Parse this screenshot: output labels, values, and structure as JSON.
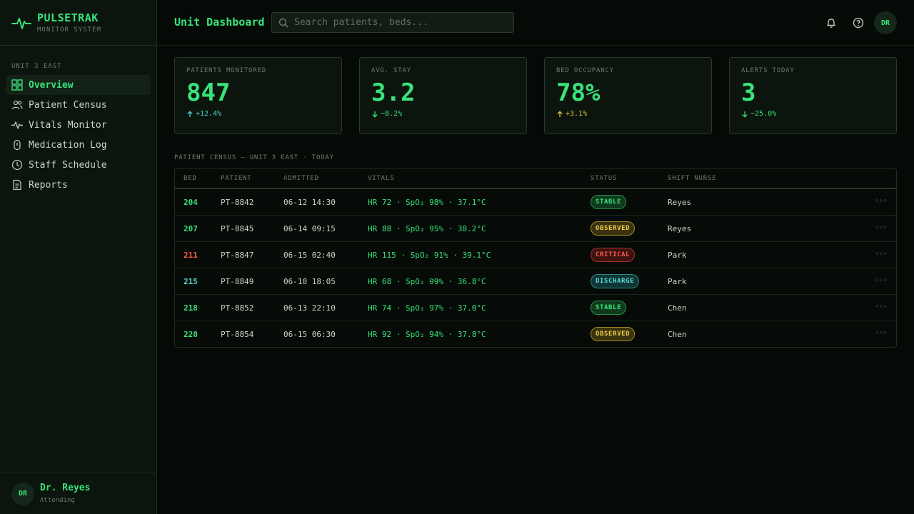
{
  "brand": {
    "name": "PULSETRAK",
    "subtitle": "MONITOR SYSTEM",
    "icon": "pulse-icon"
  },
  "sidebar": {
    "section_label": "UNIT 3 EAST",
    "items": [
      {
        "label": "Overview",
        "icon": "grid-icon",
        "active": true
      },
      {
        "label": "Patient Census",
        "icon": "users-icon",
        "active": false
      },
      {
        "label": "Vitals Monitor",
        "icon": "pulse-icon",
        "active": false
      },
      {
        "label": "Medication Log",
        "icon": "capsule-icon",
        "active": false
      },
      {
        "label": "Staff Schedule",
        "icon": "clock-icon",
        "active": false
      },
      {
        "label": "Reports",
        "icon": "document-icon",
        "active": false
      }
    ],
    "user": {
      "initials": "DR",
      "name": "Dr. Reyes",
      "role": "Attending"
    }
  },
  "header": {
    "title": "Unit Dashboard",
    "search_placeholder": "Search patients, beds...",
    "avatar_initials": "DR"
  },
  "stats": [
    {
      "label": "PATIENTS MONITORED",
      "value": "847",
      "delta": "+12.4%",
      "direction": "up",
      "color": "#4cd3d0"
    },
    {
      "label": "AVG. STAY",
      "value": "3.2",
      "delta": "−8.2%",
      "direction": "down",
      "color": "#39e27a"
    },
    {
      "label": "BED OCCUPANCY",
      "value": "78%",
      "delta": "+3.1%",
      "direction": "up",
      "color": "#e0c341"
    },
    {
      "label": "ALERTS TODAY",
      "value": "3",
      "delta": "−25.0%",
      "direction": "down",
      "color": "#39e27a"
    }
  ],
  "table": {
    "caption": "PATIENT CENSUS — UNIT 3 EAST · TODAY",
    "columns": [
      "BED",
      "PATIENT",
      "ADMITTED",
      "VITALS",
      "STATUS",
      "SHIFT NURSE"
    ],
    "rows": [
      {
        "bed": "204",
        "patient": "PT-8842",
        "admitted": "06-12 14:30",
        "vitals": "HR 72 · SpO₂ 98% · 37.1°C",
        "status": "STABLE",
        "nurse": "Reyes"
      },
      {
        "bed": "207",
        "patient": "PT-8845",
        "admitted": "06-14 09:15",
        "vitals": "HR 88 · SpO₂ 95% · 38.2°C",
        "status": "OBSERVED",
        "nurse": "Reyes"
      },
      {
        "bed": "211",
        "patient": "PT-8847",
        "admitted": "06-15 02:40",
        "vitals": "HR 115 · SpO₂ 91% · 39.1°C",
        "status": "CRITICAL",
        "nurse": "Park"
      },
      {
        "bed": "215",
        "patient": "PT-8849",
        "admitted": "06-10 18:05",
        "vitals": "HR 68 · SpO₂ 99% · 36.8°C",
        "status": "DISCHARGE",
        "nurse": "Park"
      },
      {
        "bed": "218",
        "patient": "PT-8852",
        "admitted": "06-13 22:10",
        "vitals": "HR 74 · SpO₂ 97% · 37.0°C",
        "status": "STABLE",
        "nurse": "Chen"
      },
      {
        "bed": "220",
        "patient": "PT-8854",
        "admitted": "06-15 06:30",
        "vitals": "HR 92 · SpO₂ 94% · 37.8°C",
        "status": "OBSERVED",
        "nurse": "Chen"
      }
    ],
    "row_action_icon": "more-icon"
  },
  "status_colors": {
    "STABLE": {
      "text": "#39e27a",
      "bg": "#0f3a1c",
      "border": "#2a8a48"
    },
    "OBSERVED": {
      "text": "#f0d04a",
      "bg": "#3a3210",
      "border": "#a08a22"
    },
    "CRITICAL": {
      "text": "#ff5a4a",
      "bg": "#3d1210",
      "border": "#a8302a"
    },
    "DISCHARGE": {
      "text": "#5fd8d4",
      "bg": "#0f3536",
      "border": "#2a8a88"
    }
  },
  "bed_colors": {
    "CRITICAL": "#ff5a4a",
    "DISCHARGE": "#5fd8d4"
  }
}
